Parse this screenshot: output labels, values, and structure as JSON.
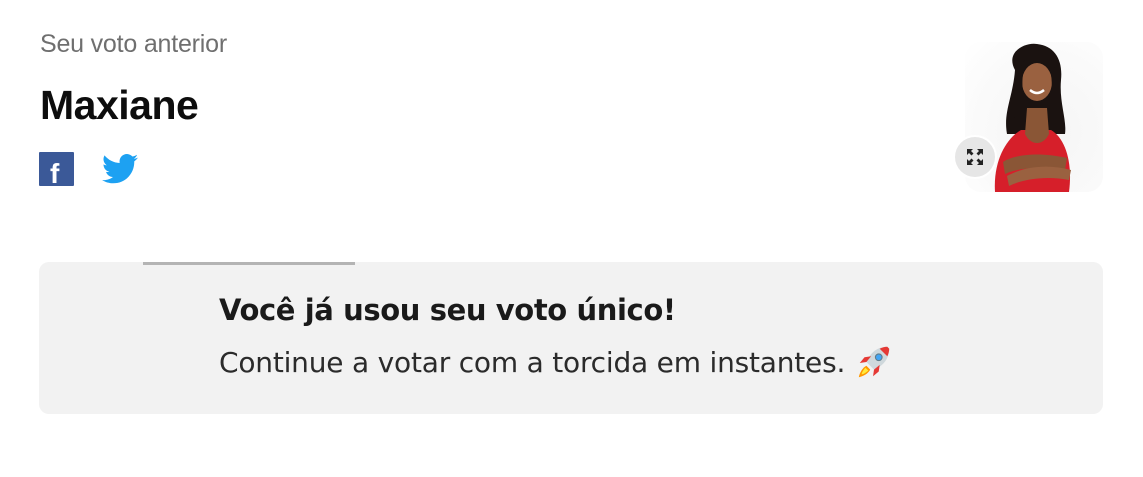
{
  "previous_vote": {
    "label": "Seu voto anterior",
    "candidate_name": "Maxiane"
  },
  "share": {
    "facebook_icon": "facebook-icon",
    "facebook_glyph": "f",
    "facebook_color": "#3b5998",
    "twitter_icon": "twitter-icon",
    "twitter_color": "#1da1f2"
  },
  "photo": {
    "expand_icon": "expand-icon"
  },
  "notice": {
    "title": "Você já usou seu voto único!",
    "message": "Continue a votar com a torcida em instantes.",
    "icon": "rocket-icon",
    "background": "#f2f2f2"
  }
}
